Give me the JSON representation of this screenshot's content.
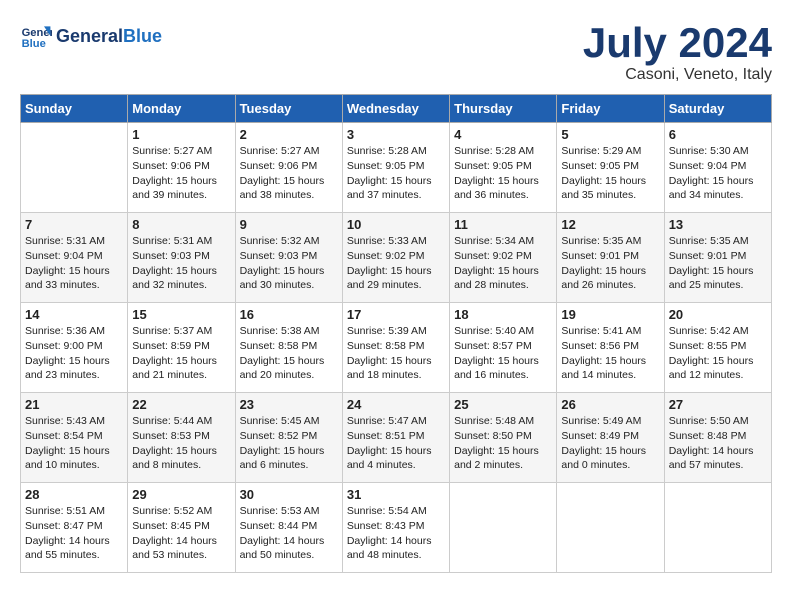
{
  "header": {
    "logo_line1": "General",
    "logo_line2": "Blue",
    "month_year": "July 2024",
    "location": "Casoni, Veneto, Italy"
  },
  "weekdays": [
    "Sunday",
    "Monday",
    "Tuesday",
    "Wednesday",
    "Thursday",
    "Friday",
    "Saturday"
  ],
  "weeks": [
    [
      {
        "day": "",
        "sunrise": "",
        "sunset": "",
        "daylight": ""
      },
      {
        "day": "1",
        "sunrise": "Sunrise: 5:27 AM",
        "sunset": "Sunset: 9:06 PM",
        "daylight": "Daylight: 15 hours and 39 minutes."
      },
      {
        "day": "2",
        "sunrise": "Sunrise: 5:27 AM",
        "sunset": "Sunset: 9:06 PM",
        "daylight": "Daylight: 15 hours and 38 minutes."
      },
      {
        "day": "3",
        "sunrise": "Sunrise: 5:28 AM",
        "sunset": "Sunset: 9:05 PM",
        "daylight": "Daylight: 15 hours and 37 minutes."
      },
      {
        "day": "4",
        "sunrise": "Sunrise: 5:28 AM",
        "sunset": "Sunset: 9:05 PM",
        "daylight": "Daylight: 15 hours and 36 minutes."
      },
      {
        "day": "5",
        "sunrise": "Sunrise: 5:29 AM",
        "sunset": "Sunset: 9:05 PM",
        "daylight": "Daylight: 15 hours and 35 minutes."
      },
      {
        "day": "6",
        "sunrise": "Sunrise: 5:30 AM",
        "sunset": "Sunset: 9:04 PM",
        "daylight": "Daylight: 15 hours and 34 minutes."
      }
    ],
    [
      {
        "day": "7",
        "sunrise": "Sunrise: 5:31 AM",
        "sunset": "Sunset: 9:04 PM",
        "daylight": "Daylight: 15 hours and 33 minutes."
      },
      {
        "day": "8",
        "sunrise": "Sunrise: 5:31 AM",
        "sunset": "Sunset: 9:03 PM",
        "daylight": "Daylight: 15 hours and 32 minutes."
      },
      {
        "day": "9",
        "sunrise": "Sunrise: 5:32 AM",
        "sunset": "Sunset: 9:03 PM",
        "daylight": "Daylight: 15 hours and 30 minutes."
      },
      {
        "day": "10",
        "sunrise": "Sunrise: 5:33 AM",
        "sunset": "Sunset: 9:02 PM",
        "daylight": "Daylight: 15 hours and 29 minutes."
      },
      {
        "day": "11",
        "sunrise": "Sunrise: 5:34 AM",
        "sunset": "Sunset: 9:02 PM",
        "daylight": "Daylight: 15 hours and 28 minutes."
      },
      {
        "day": "12",
        "sunrise": "Sunrise: 5:35 AM",
        "sunset": "Sunset: 9:01 PM",
        "daylight": "Daylight: 15 hours and 26 minutes."
      },
      {
        "day": "13",
        "sunrise": "Sunrise: 5:35 AM",
        "sunset": "Sunset: 9:01 PM",
        "daylight": "Daylight: 15 hours and 25 minutes."
      }
    ],
    [
      {
        "day": "14",
        "sunrise": "Sunrise: 5:36 AM",
        "sunset": "Sunset: 9:00 PM",
        "daylight": "Daylight: 15 hours and 23 minutes."
      },
      {
        "day": "15",
        "sunrise": "Sunrise: 5:37 AM",
        "sunset": "Sunset: 8:59 PM",
        "daylight": "Daylight: 15 hours and 21 minutes."
      },
      {
        "day": "16",
        "sunrise": "Sunrise: 5:38 AM",
        "sunset": "Sunset: 8:58 PM",
        "daylight": "Daylight: 15 hours and 20 minutes."
      },
      {
        "day": "17",
        "sunrise": "Sunrise: 5:39 AM",
        "sunset": "Sunset: 8:58 PM",
        "daylight": "Daylight: 15 hours and 18 minutes."
      },
      {
        "day": "18",
        "sunrise": "Sunrise: 5:40 AM",
        "sunset": "Sunset: 8:57 PM",
        "daylight": "Daylight: 15 hours and 16 minutes."
      },
      {
        "day": "19",
        "sunrise": "Sunrise: 5:41 AM",
        "sunset": "Sunset: 8:56 PM",
        "daylight": "Daylight: 15 hours and 14 minutes."
      },
      {
        "day": "20",
        "sunrise": "Sunrise: 5:42 AM",
        "sunset": "Sunset: 8:55 PM",
        "daylight": "Daylight: 15 hours and 12 minutes."
      }
    ],
    [
      {
        "day": "21",
        "sunrise": "Sunrise: 5:43 AM",
        "sunset": "Sunset: 8:54 PM",
        "daylight": "Daylight: 15 hours and 10 minutes."
      },
      {
        "day": "22",
        "sunrise": "Sunrise: 5:44 AM",
        "sunset": "Sunset: 8:53 PM",
        "daylight": "Daylight: 15 hours and 8 minutes."
      },
      {
        "day": "23",
        "sunrise": "Sunrise: 5:45 AM",
        "sunset": "Sunset: 8:52 PM",
        "daylight": "Daylight: 15 hours and 6 minutes."
      },
      {
        "day": "24",
        "sunrise": "Sunrise: 5:47 AM",
        "sunset": "Sunset: 8:51 PM",
        "daylight": "Daylight: 15 hours and 4 minutes."
      },
      {
        "day": "25",
        "sunrise": "Sunrise: 5:48 AM",
        "sunset": "Sunset: 8:50 PM",
        "daylight": "Daylight: 15 hours and 2 minutes."
      },
      {
        "day": "26",
        "sunrise": "Sunrise: 5:49 AM",
        "sunset": "Sunset: 8:49 PM",
        "daylight": "Daylight: 15 hours and 0 minutes."
      },
      {
        "day": "27",
        "sunrise": "Sunrise: 5:50 AM",
        "sunset": "Sunset: 8:48 PM",
        "daylight": "Daylight: 14 hours and 57 minutes."
      }
    ],
    [
      {
        "day": "28",
        "sunrise": "Sunrise: 5:51 AM",
        "sunset": "Sunset: 8:47 PM",
        "daylight": "Daylight: 14 hours and 55 minutes."
      },
      {
        "day": "29",
        "sunrise": "Sunrise: 5:52 AM",
        "sunset": "Sunset: 8:45 PM",
        "daylight": "Daylight: 14 hours and 53 minutes."
      },
      {
        "day": "30",
        "sunrise": "Sunrise: 5:53 AM",
        "sunset": "Sunset: 8:44 PM",
        "daylight": "Daylight: 14 hours and 50 minutes."
      },
      {
        "day": "31",
        "sunrise": "Sunrise: 5:54 AM",
        "sunset": "Sunset: 8:43 PM",
        "daylight": "Daylight: 14 hours and 48 minutes."
      },
      {
        "day": "",
        "sunrise": "",
        "sunset": "",
        "daylight": ""
      },
      {
        "day": "",
        "sunrise": "",
        "sunset": "",
        "daylight": ""
      },
      {
        "day": "",
        "sunrise": "",
        "sunset": "",
        "daylight": ""
      }
    ]
  ]
}
